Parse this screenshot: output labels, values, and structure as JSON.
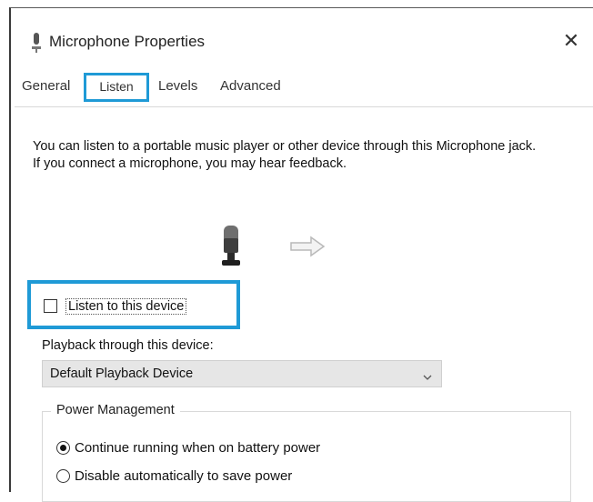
{
  "window": {
    "title": "Microphone Properties",
    "close_symbol": "✕"
  },
  "tabs": [
    {
      "label": "General",
      "active": false
    },
    {
      "label": "Listen",
      "active": true
    },
    {
      "label": "Levels",
      "active": false
    },
    {
      "label": "Advanced",
      "active": false
    }
  ],
  "listen": {
    "description": "You can listen to a portable music player or other device through this Microphone jack.  If you connect a microphone, you may hear feedback.",
    "checkbox_label": "Listen to this device",
    "checkbox_checked": false,
    "playback_label": "Playback through this device:",
    "playback_selected": "Default Playback Device"
  },
  "power": {
    "group_title": "Power Management",
    "options": [
      {
        "label": "Continue running when on battery power",
        "selected": true
      },
      {
        "label": "Disable automatically to save power",
        "selected": false
      }
    ]
  },
  "colors": {
    "highlight": "#1f9ad6"
  },
  "icons": {
    "title": "microphone-icon",
    "device": "microphone-icon",
    "flow": "arrow-right-icon",
    "dropdown": "chevron-down-icon"
  }
}
